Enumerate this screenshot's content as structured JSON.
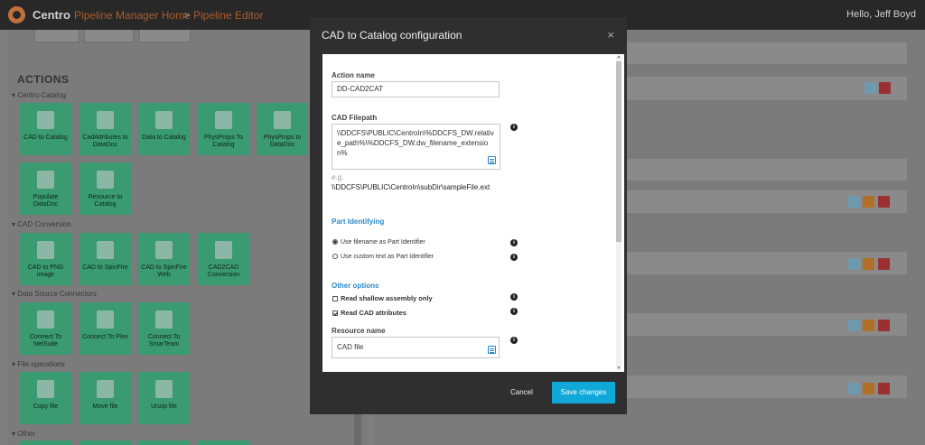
{
  "topbar": {
    "brand": "Centro",
    "breadcrumb": [
      "Pipeline Manager Home",
      "Pipeline Editor"
    ],
    "separator": ">",
    "user_greeting": "Hello, Jeff Boyd"
  },
  "actions": {
    "title": "ACTIONS",
    "groups": [
      {
        "label": "Centro Catalog",
        "tiles": [
          "CAD to Catalog",
          "CadAttributes to DataDoc",
          "Data to Catalog",
          "PhysProps To Catalog",
          "PhysProps to DataDoc",
          "Populate DataDoc",
          "Resource to Catalog"
        ]
      },
      {
        "label": "CAD Conversion",
        "tiles": [
          "CAD to PNG image",
          "CAD to SpinFire",
          "CAD to SpinFire Web",
          "CAD2CAD Conversion"
        ]
      },
      {
        "label": "Data Source Connectors",
        "tiles": [
          "Connect To NetSuite",
          "Connect To Plex",
          "Connect To SmarTeam"
        ]
      },
      {
        "label": "File operations",
        "tiles": [
          "Copy file",
          "Move file",
          "Unzip file"
        ]
      },
      {
        "label": "Other",
        "tiles": []
      }
    ]
  },
  "modal": {
    "title": "CAD to Catalog configuration",
    "close": "×",
    "action_name_label": "Action name",
    "action_name_value": "DD-CAD2CAT",
    "cad_filepath_label": "CAD Filepath",
    "cad_filepath_value": "\\\\DDCFS\\PUBLIC\\CentroIn\\%DDCFS_DW.relative_path%\\%DDCFS_DW.dw_filename_extension%",
    "eg_label": "e.g.",
    "eg_value": "\\\\DDCFS\\PUBLIC\\CentroIn\\subDir\\sampleFile.ext",
    "part_identifying_label": "Part Identifying",
    "radio_filename": "Use filename as Part Identifier",
    "radio_custom": "Use custom text as Part Identifier",
    "other_options_label": "Other options",
    "chk_shallow": "Read shallow assembly only",
    "chk_cad_attrs": "Read CAD attributes",
    "resource_name_label": "Resource name",
    "resource_name_value": "CAD file",
    "cancel": "Cancel",
    "save": "Save changes",
    "info_glyph": "i"
  }
}
